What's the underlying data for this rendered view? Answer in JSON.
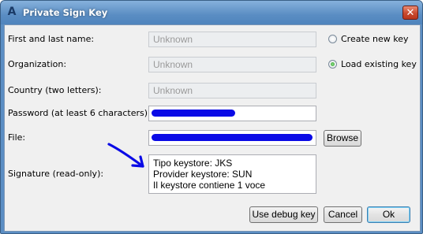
{
  "window": {
    "title": "Private Sign Key",
    "app_icon": "A",
    "close_glyph": "✕"
  },
  "form": {
    "name_label": "First and last name:",
    "name_value": "Unknown",
    "org_label": "Organization:",
    "org_value": "Unknown",
    "country_label": "Country (two letters):",
    "country_value": "Unknown",
    "password_label": "Password (at least 6 characters):",
    "file_label": "File:",
    "signature_label": "Signature (read-only):",
    "signature_lines": [
      "Tipo keystore: JKS",
      "Provider keystore: SUN",
      "Il keystore contiene 1 voce"
    ]
  },
  "options": {
    "create_new": "Create new key",
    "load_existing": "Load existing key",
    "selected": "load_existing"
  },
  "buttons": {
    "browse": "Browse",
    "debug": "Use debug key",
    "cancel": "Cancel",
    "ok": "Ok"
  },
  "colors": {
    "scribble": "#0a0ae6",
    "arrow": "#0a0ae6"
  }
}
